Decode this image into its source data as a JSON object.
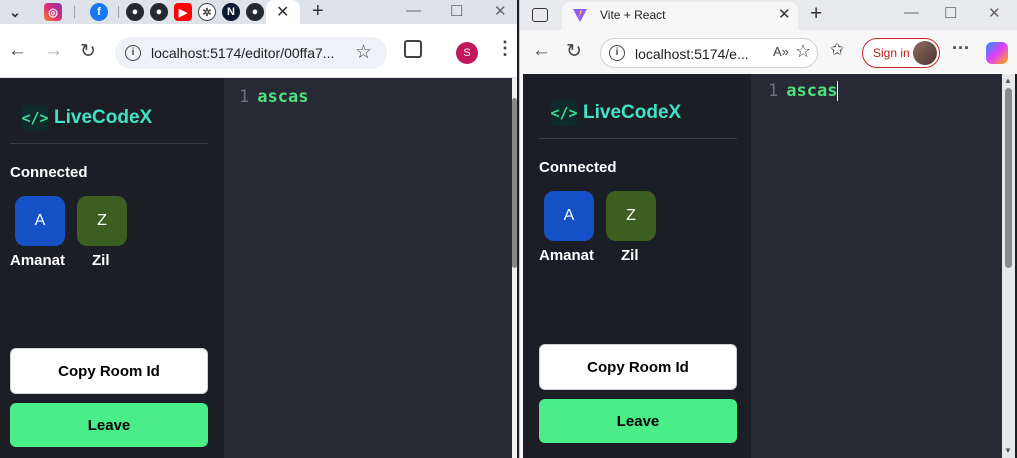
{
  "left_window": {
    "tabs": [
      {
        "icon": "instagram-icon",
        "color": "#e1306c"
      },
      {
        "icon": "facebook-icon",
        "color": "#1877f2"
      },
      {
        "icon": "github-icon",
        "color": "#24292e"
      },
      {
        "icon": "github-icon",
        "color": "#24292e"
      },
      {
        "icon": "youtube-icon",
        "color": "#ff0000"
      },
      {
        "icon": "openai-icon",
        "color": "#444444"
      },
      {
        "icon": "notion-icon",
        "color": "#0b1a2e",
        "letter": "N"
      },
      {
        "icon": "github-icon",
        "color": "#24292e"
      }
    ],
    "address": "localhost:5174/editor/00ffa7...",
    "profile_letter": "S"
  },
  "right_window": {
    "tab_title": "Vite + React",
    "address": "localhost:5174/e...",
    "signin_label": "Sign in"
  },
  "app": {
    "brand": "LiveCodeX",
    "logo_glyph": "</>",
    "connected_label": "Connected",
    "clients": [
      {
        "initial": "A",
        "name": "Amanat",
        "color": "#1451c7"
      },
      {
        "initial": "Z",
        "name": "Zil",
        "color": "#3b5e21"
      }
    ],
    "copy_button": "Copy Room Id",
    "leave_button": "Leave",
    "editor": {
      "line_number": "1",
      "code": "ascas"
    }
  }
}
